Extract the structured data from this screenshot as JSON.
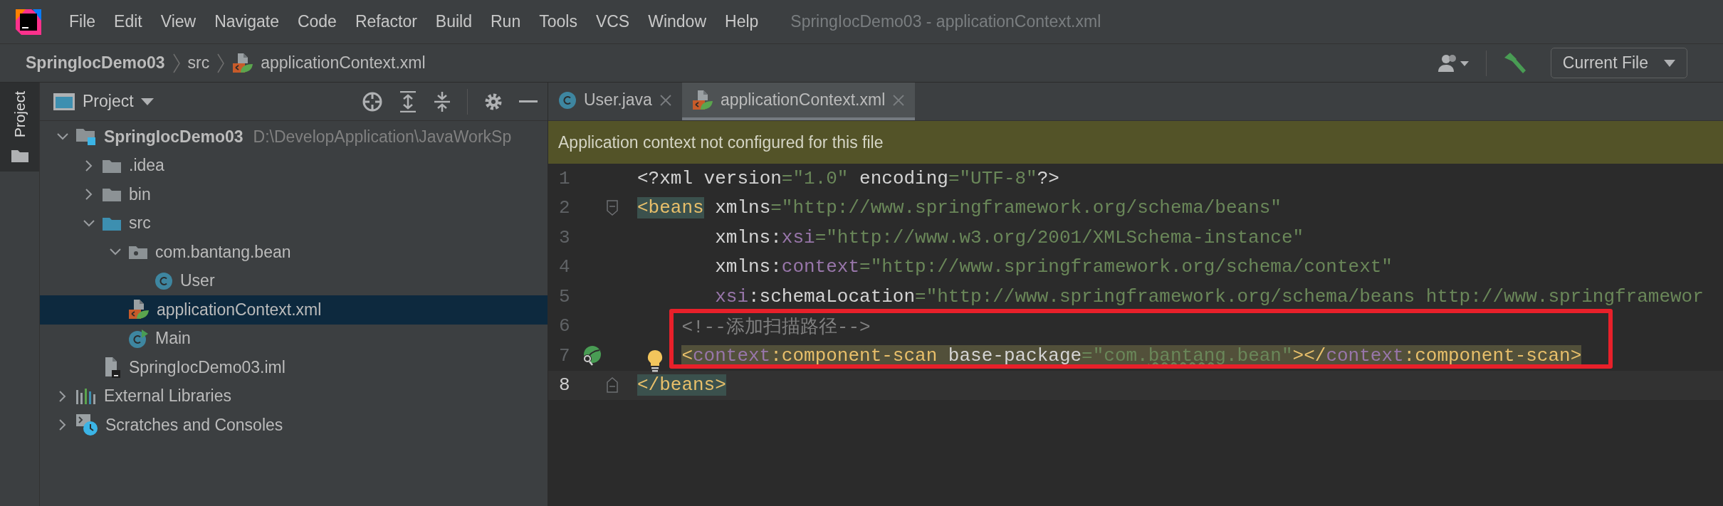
{
  "menu_bar": {
    "items": [
      {
        "label": "File"
      },
      {
        "label": "Edit"
      },
      {
        "label": "View"
      },
      {
        "label": "Navigate"
      },
      {
        "label": "Code"
      },
      {
        "label": "Refactor"
      },
      {
        "label": "Build"
      },
      {
        "label": "Run"
      },
      {
        "label": "Tools"
      },
      {
        "label": "VCS"
      },
      {
        "label": "Window"
      },
      {
        "label": "Help"
      }
    ],
    "title": "SpringIocDemo03 - applicationContext.xml"
  },
  "breadcrumb": [
    {
      "label": "SpringIocDemo03",
      "kind": "project"
    },
    {
      "label": "src",
      "kind": "folder"
    },
    {
      "label": "applicationContext.xml",
      "kind": "xml"
    }
  ],
  "toolbar": {
    "run_config": "Current File"
  },
  "side_stripe": [
    {
      "label": "Project",
      "selected": true
    }
  ],
  "project_panel": {
    "title": "Project",
    "tree": [
      {
        "label": "SpringIocDemo03",
        "path": "D:\\DevelopApplication\\JavaWorkSp",
        "kind": "module",
        "expanded": true,
        "selected": false,
        "children": [
          {
            "label": ".idea",
            "kind": "folder",
            "expanded": false,
            "selected": false
          },
          {
            "label": "bin",
            "kind": "folder",
            "expanded": false,
            "selected": false
          },
          {
            "label": "src",
            "kind": "source-folder",
            "expanded": true,
            "selected": false,
            "children": [
              {
                "label": "com.bantang.bean",
                "kind": "package",
                "expanded": true,
                "selected": false,
                "children": [
                  {
                    "label": "User",
                    "kind": "class",
                    "selected": false
                  }
                ]
              },
              {
                "label": "applicationContext.xml",
                "kind": "xml",
                "selected": true
              },
              {
                "label": "Main",
                "kind": "main-class",
                "selected": false
              }
            ]
          },
          {
            "label": "SpringIocDemo03.iml",
            "kind": "iml",
            "selected": false
          }
        ]
      },
      {
        "label": "External Libraries",
        "kind": "libraries",
        "expanded": false,
        "selected": false
      },
      {
        "label": "Scratches and Consoles",
        "kind": "scratches",
        "expanded": false,
        "selected": false
      }
    ]
  },
  "editor": {
    "tabs": [
      {
        "label": "User.java",
        "kind": "class",
        "selected": false
      },
      {
        "label": "applicationContext.xml",
        "kind": "xml",
        "selected": true
      }
    ],
    "banner": "Application context not configured for this file",
    "lines": [
      {
        "number": "1",
        "kind": "prolog",
        "current": false,
        "highlighted": false,
        "boxed": false,
        "bulb": false,
        "tokens": [
          {
            "kind": "text",
            "text": "<?xml version"
          },
          {
            "kind": "value",
            "text": "=\"1.0\""
          },
          {
            "kind": "text",
            "text": " encoding"
          },
          {
            "kind": "value",
            "text": "=\"UTF-8\""
          },
          {
            "kind": "text",
            "text": "?>"
          }
        ]
      },
      {
        "number": "2",
        "kind": "open-tag",
        "current": false,
        "highlighted": false,
        "boxed": false,
        "bulb": false,
        "tokens": [
          {
            "kind": "tag-match",
            "text": "<beans"
          },
          {
            "kind": "text",
            "text": " xmlns"
          },
          {
            "kind": "value",
            "text": "=\"http://www.springframework.org/schema/beans\""
          }
        ]
      },
      {
        "number": "3",
        "kind": "attribute",
        "current": false,
        "highlighted": false,
        "boxed": false,
        "bulb": false,
        "tokens": [
          {
            "kind": "text",
            "text": "xmlns:"
          },
          {
            "kind": "ns",
            "text": "xsi"
          },
          {
            "kind": "value",
            "text": "=\"http://www.w3.org/2001/XMLSchema-instance\""
          }
        ]
      },
      {
        "number": "4",
        "kind": "attribute",
        "current": false,
        "highlighted": false,
        "boxed": false,
        "bulb": false,
        "tokens": [
          {
            "kind": "text",
            "text": "xmlns:"
          },
          {
            "kind": "ns",
            "text": "context"
          },
          {
            "kind": "value",
            "text": "=\"http://www.springframework.org/schema/context\""
          }
        ]
      },
      {
        "number": "5",
        "kind": "attribute",
        "current": false,
        "highlighted": false,
        "boxed": false,
        "bulb": false,
        "tokens": [
          {
            "kind": "ns",
            "text": "xsi"
          },
          {
            "kind": "text",
            "text": ":schemaLocation"
          },
          {
            "kind": "value",
            "text": "=\"http://www.springframework.org/schema/beans http://www.springframewor"
          }
        ]
      },
      {
        "number": "6",
        "kind": "child",
        "current": false,
        "highlighted": false,
        "boxed": true,
        "bulb": false,
        "tokens": [
          {
            "kind": "comment",
            "text": "<!--添加扫描路径-->"
          }
        ]
      },
      {
        "number": "7",
        "kind": "bean-child",
        "current": false,
        "highlighted": true,
        "boxed": true,
        "bulb": true,
        "tokens": [
          {
            "kind": "tag",
            "text": "<"
          },
          {
            "kind": "ns",
            "text": "context"
          },
          {
            "kind": "tag",
            "text": ":component-scan"
          },
          {
            "kind": "text",
            "text": " base-package"
          },
          {
            "kind": "value",
            "text": "=\"com."
          },
          {
            "kind": "value-typo",
            "text": "bantang"
          },
          {
            "kind": "value",
            "text": ".bean\""
          },
          {
            "kind": "tag",
            "text": "></"
          },
          {
            "kind": "ns",
            "text": "context"
          },
          {
            "kind": "tag",
            "text": ":component-scan>"
          }
        ]
      },
      {
        "number": "8",
        "kind": "close-tag",
        "current": true,
        "highlighted": false,
        "boxed": false,
        "bulb": false,
        "tokens": [
          {
            "kind": "tag-match",
            "text": "</beans>"
          }
        ]
      }
    ]
  }
}
